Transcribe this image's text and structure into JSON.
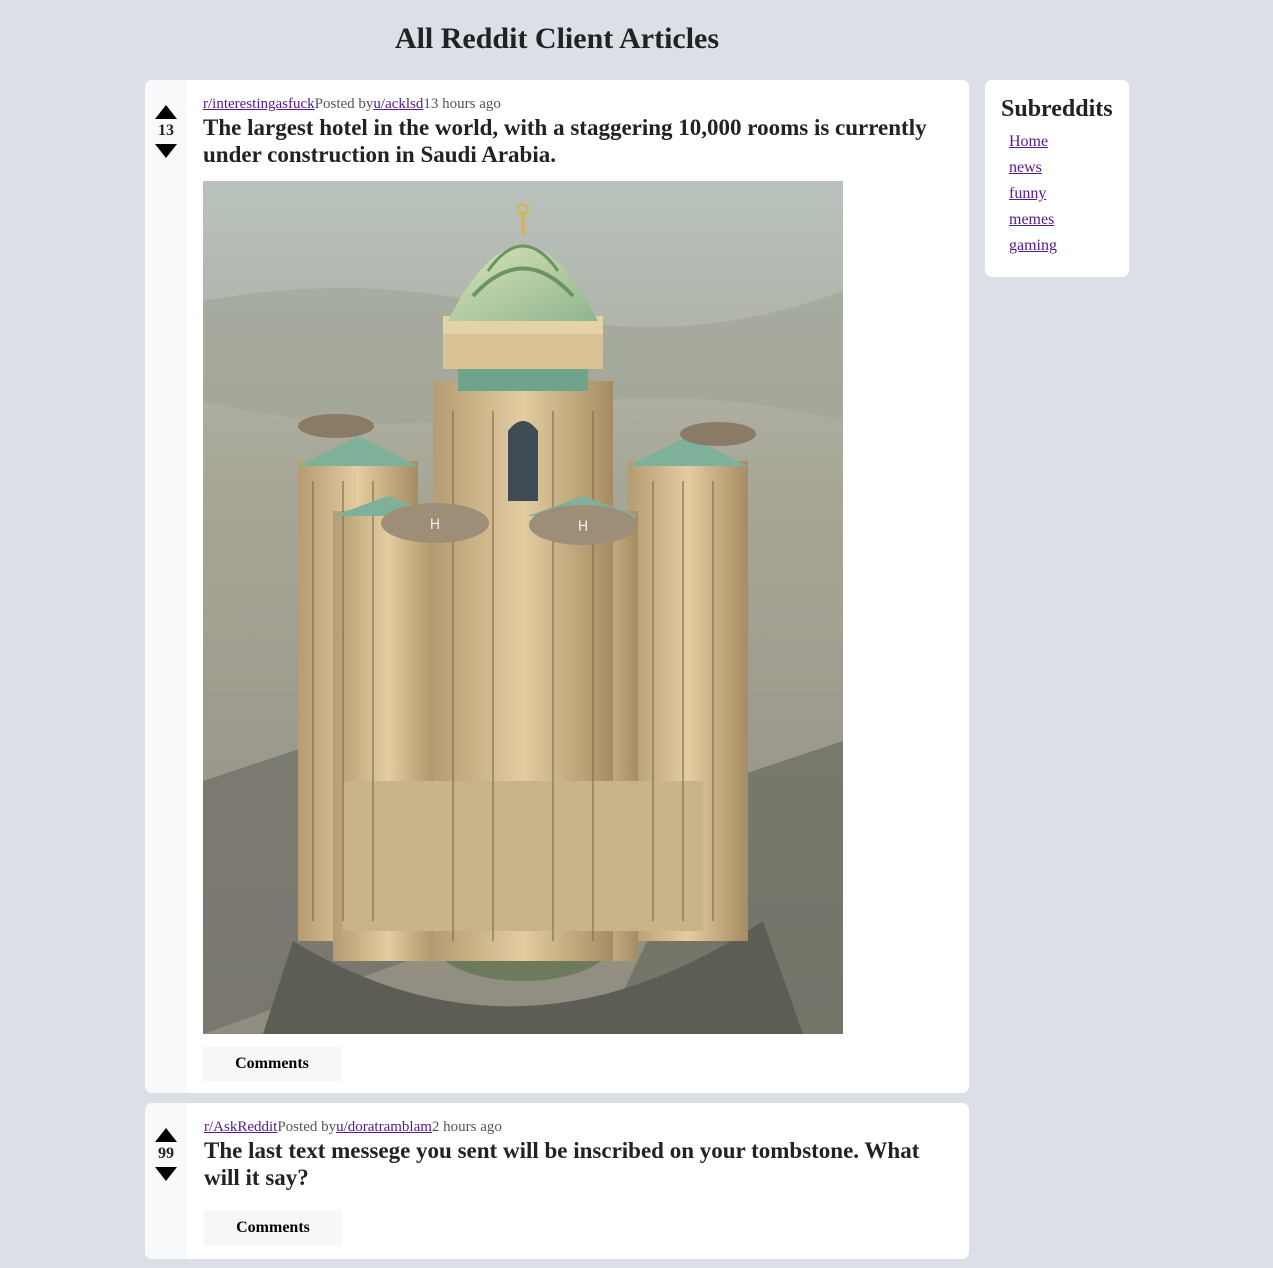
{
  "page": {
    "title": "All Reddit Client Articles"
  },
  "posts": [
    {
      "votes": "13",
      "subreddit": "r/interestingasfuck",
      "posted_by_label": "Posted by",
      "author": "u/acklsd",
      "time": "13 hours ago",
      "title": "The largest hotel in the world, with a staggering 10,000 rooms is currently under construction in Saudi Arabia.",
      "comments_label": "Comments"
    },
    {
      "votes": "99",
      "subreddit": "r/AskReddit",
      "posted_by_label": "Posted by",
      "author": "u/doratramblam",
      "time": "2 hours ago",
      "title": "The last text messege you sent will be inscribed on your tombstone. What will it say?",
      "comments_label": "Comments"
    }
  ],
  "sidebar": {
    "title": "Subreddits",
    "items": [
      "Home",
      "news",
      "funny",
      "memes",
      "gaming"
    ]
  }
}
